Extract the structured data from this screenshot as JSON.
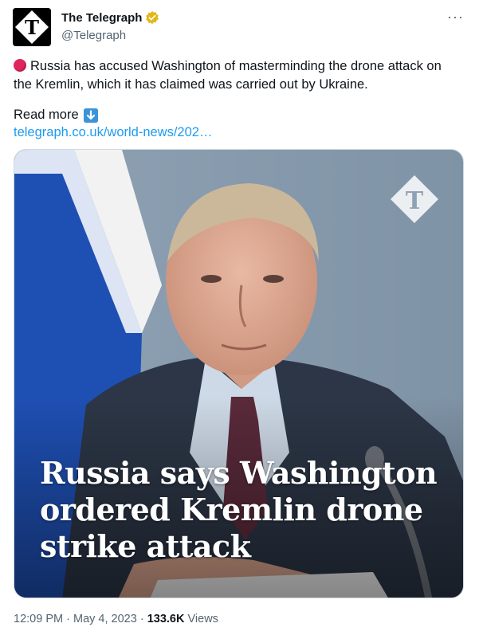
{
  "account": {
    "display_name": "The Telegraph",
    "handle": "@Telegraph",
    "verified_badge_color": "#e2b719",
    "avatar_letter": "T"
  },
  "menu": {
    "more_label": "···"
  },
  "tweet": {
    "text": "Russia has accused Washington of masterminding the drone attack on the Kremlin, which it has claimed was carried out by Ukraine.",
    "read_more_label": "Read more",
    "link_text": "telegraph.co.uk/world-news/202…"
  },
  "media": {
    "headline": "Russia says Washington ordered Kremlin drone strike attack",
    "watermark_letter": "T"
  },
  "meta": {
    "time": "12:09 PM",
    "separator": "·",
    "date": "May 4, 2023",
    "views_count": "133.6K",
    "views_label": "Views"
  },
  "colors": {
    "link": "#1d9bf0",
    "secondary_text": "#536471",
    "red_circle": "#e0245e",
    "arrow_button": "#3b94d9"
  }
}
